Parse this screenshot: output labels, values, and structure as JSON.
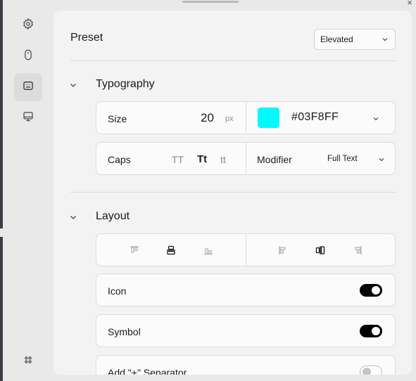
{
  "colors": {
    "accent_swatch": "#03F8FF",
    "panel_bg": "#f3f3f3",
    "card_bg": "#fbfbfb",
    "toggle_on": "#000000"
  },
  "rail": {
    "items": [
      {
        "name": "settings",
        "icon": "gear-icon",
        "active": false
      },
      {
        "name": "mouse",
        "icon": "mouse-icon",
        "active": false
      },
      {
        "name": "keyboard",
        "icon": "keyboard-icon",
        "active": true
      },
      {
        "name": "display",
        "icon": "monitor-icon",
        "active": false
      }
    ],
    "bottom_icon": "apps-grid-icon"
  },
  "header": {
    "close_glyph": "×"
  },
  "preset": {
    "label": "Preset",
    "selected": "Elevated"
  },
  "typography": {
    "title": "Typography",
    "size_label": "Size",
    "size_value": "20",
    "size_unit": "px",
    "color_hex": "#03F8FF",
    "caps_label": "Caps",
    "caps_options": [
      "TT",
      "Tt",
      "tt"
    ],
    "caps_selected": "Tt",
    "modifier_label": "Modifier",
    "modifier_selected": "Full Text"
  },
  "layout": {
    "title": "Layout",
    "vertical_align_icons": [
      "align-top-icon",
      "align-center-vertical-icon",
      "align-bottom-icon"
    ],
    "vertical_align_selected": "align-center-vertical-icon",
    "horizontal_align_icons": [
      "align-left-icon",
      "align-center-horizontal-icon",
      "align-right-icon"
    ],
    "horizontal_align_selected": "align-center-horizontal-icon",
    "toggles": [
      {
        "label": "Icon",
        "on": true
      },
      {
        "label": "Symbol",
        "on": true
      },
      {
        "label": "Add \"+\" Separator",
        "on": false
      }
    ]
  }
}
